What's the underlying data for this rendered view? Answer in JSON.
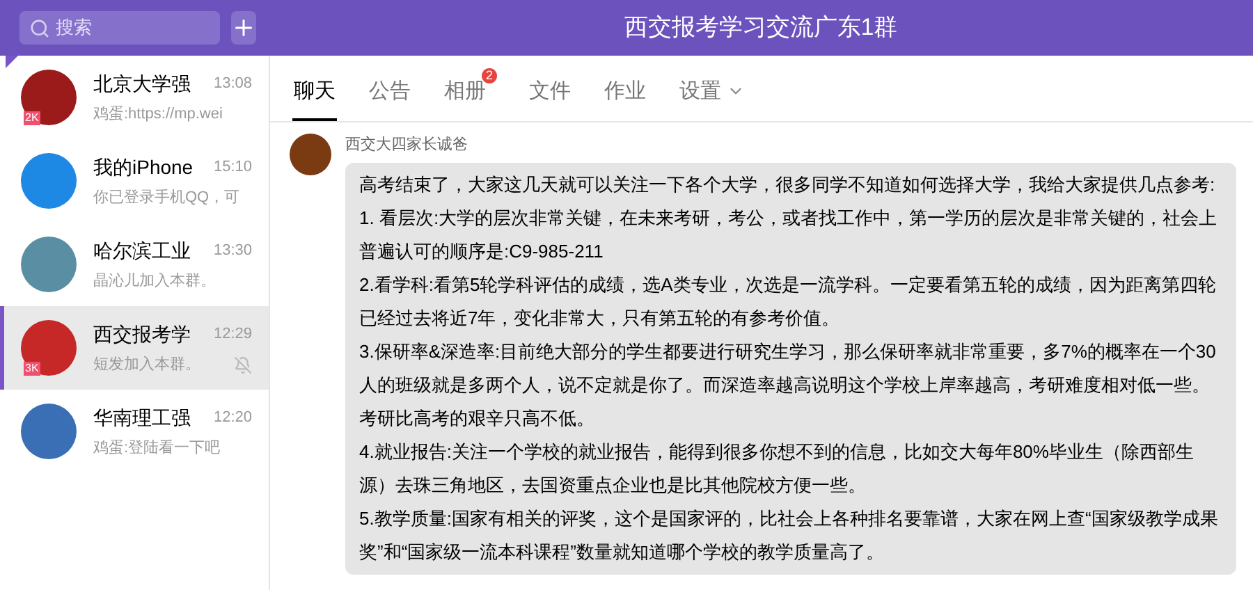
{
  "search": {
    "placeholder": "搜索"
  },
  "chat_title": "西交报考学习交流广东1群",
  "chats": [
    {
      "name": "北京大学强",
      "time": "13:08",
      "preview": "鸡蛋:https://mp.wei",
      "badge": "2K",
      "color": "#9b1b1b",
      "selected": false,
      "muted": false,
      "pinned": true
    },
    {
      "name": "我的iPhone",
      "time": "15:10",
      "preview": "你已登录手机QQ，可",
      "color": "#1e88e5",
      "selected": false,
      "muted": false,
      "pinned": false
    },
    {
      "name": "哈尔滨工业",
      "time": "13:30",
      "preview": "晶沁儿加入本群。",
      "color": "#5a8fa3",
      "selected": false,
      "muted": false,
      "pinned": false
    },
    {
      "name": "西交报考学",
      "time": "12:29",
      "preview": "短发加入本群。",
      "badge": "3K",
      "color": "#c62828",
      "selected": true,
      "muted": true,
      "pinned": false
    },
    {
      "name": "华南理工强",
      "time": "12:20",
      "preview": "鸡蛋:登陆看一下吧",
      "color": "#3b6fb5",
      "selected": false,
      "muted": false,
      "pinned": false
    }
  ],
  "tabs": [
    {
      "label": "聊天",
      "selected": true
    },
    {
      "label": "公告",
      "selected": false
    },
    {
      "label": "相册",
      "selected": false,
      "badge": "2"
    },
    {
      "label": "文件",
      "selected": false
    },
    {
      "label": "作业",
      "selected": false
    },
    {
      "label": "设置",
      "selected": false,
      "dropdown": true
    }
  ],
  "message": {
    "sender": "西交大四家长诚爸",
    "lines": [
      "高考结束了，大家这几天就可以关注一下各个大学，很多同学不知道如何选择大学，我给大家提供几点参考:",
      "1. 看层次:大学的层次非常关键，在未来考研，考公，或者找工作中，第一学历的层次是非常关键的，社会上普遍认可的顺序是:C9-985-211",
      "2.看学科:看第5轮学科评估的成绩，选A类专业，次选是一流学科。一定要看第五轮的成绩，因为距离第四轮已经过去将近7年，变化非常大，只有第五轮的有参考价值。",
      "3.保研率&深造率:目前绝大部分的学生都要进行研究生学习，那么保研率就非常重要，多7%的概率在一个30人的班级就是多两个人，说不定就是你了。而深造率越高说明这个学校上岸率越高，考研难度相对低一些。考研比高考的艰辛只高不低。",
      "4.就业报告:关注一个学校的就业报告，能得到很多你想不到的信息，比如交大每年80%毕业生（除西部生源）去珠三角地区，去国资重点企业也是比其他院校方便一些。",
      "5.教学质量:国家有相关的评奖，这个是国家评的，比社会上各种排名要靠谱，大家在网上查“国家级教学成果奖”和“国家级一流本科课程”数量就知道哪个学校的教学质量高了。"
    ]
  }
}
